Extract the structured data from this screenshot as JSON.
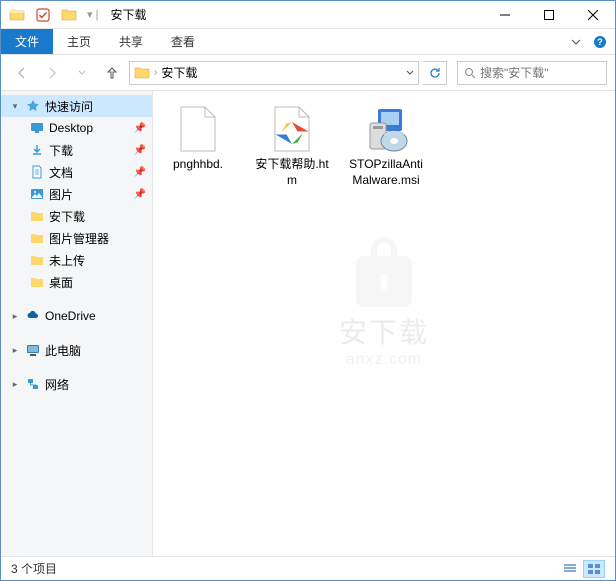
{
  "titlebar": {
    "title": "安下载"
  },
  "ribbon": {
    "file": "文件",
    "home": "主页",
    "share": "共享",
    "view": "查看"
  },
  "addressbar": {
    "location": "安下载"
  },
  "search": {
    "placeholder": "搜索\"安下载\""
  },
  "sidebar": {
    "quickaccess": "快速访问",
    "items": [
      {
        "label": "Desktop",
        "icon": "desktop"
      },
      {
        "label": "下载",
        "icon": "download"
      },
      {
        "label": "文档",
        "icon": "document"
      },
      {
        "label": "图片",
        "icon": "pictures"
      },
      {
        "label": "安下载",
        "icon": "folder"
      },
      {
        "label": "图片管理器",
        "icon": "folder"
      },
      {
        "label": "未上传",
        "icon": "folder"
      },
      {
        "label": "桌面",
        "icon": "folder"
      }
    ],
    "onedrive": "OneDrive",
    "thispc": "此电脑",
    "network": "网络"
  },
  "files": [
    {
      "name": "pnghhbd.",
      "type": "blank"
    },
    {
      "name": "安下载帮助.htm",
      "type": "htm"
    },
    {
      "name": "STOPzillaAntiMalware.msi",
      "type": "msi"
    }
  ],
  "statusbar": {
    "count": "3 个项目"
  },
  "watermark": {
    "text": "安下载",
    "sub": "anxz.com"
  }
}
